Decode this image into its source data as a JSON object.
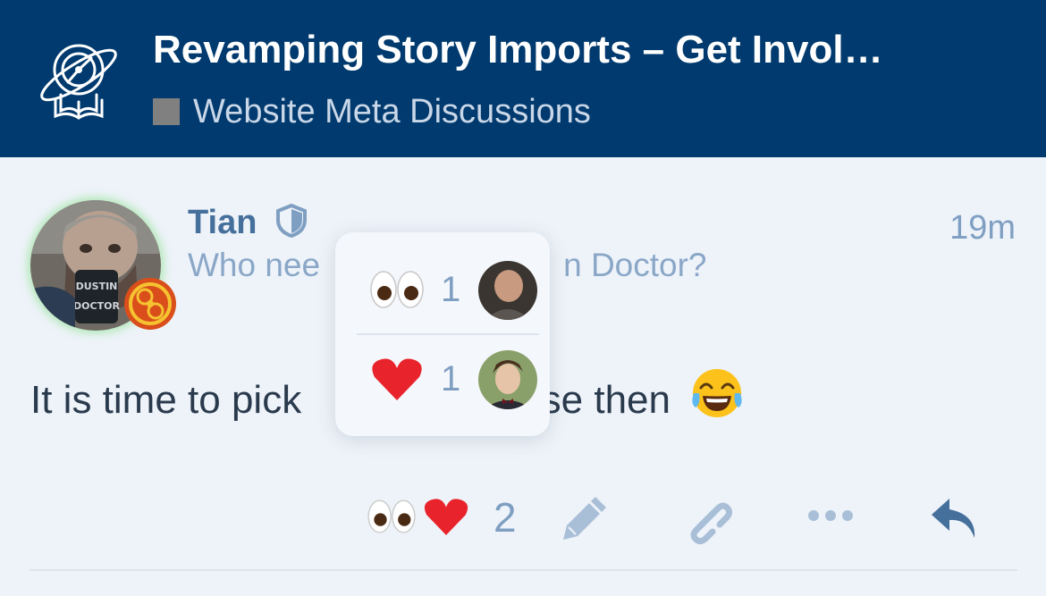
{
  "header": {
    "topic_title": "Revamping Story Imports – Get Invol…",
    "category": "Website Meta Discussions",
    "category_color": "#808080",
    "background": "#003a6e"
  },
  "post": {
    "username": "Tian",
    "user_title": "Who nee",
    "user_title_tail": "n Doctor?",
    "time": "19m",
    "body_start": "It is time to pick",
    "body_end": "ase then",
    "body_emoji": "face-with-tears-of-joy-icon"
  },
  "reactions_popup": {
    "items": [
      {
        "emoji": "eyes-icon",
        "count": "1"
      },
      {
        "emoji": "red-heart-icon",
        "count": "1"
      }
    ]
  },
  "actions": {
    "reaction_total": "2",
    "icons": [
      "eyes-icon",
      "red-heart-icon",
      "pencil-icon",
      "link-icon",
      "more-icon",
      "reply-icon"
    ],
    "icon_color": "#a9bfd8",
    "reply_color": "#46709c"
  }
}
